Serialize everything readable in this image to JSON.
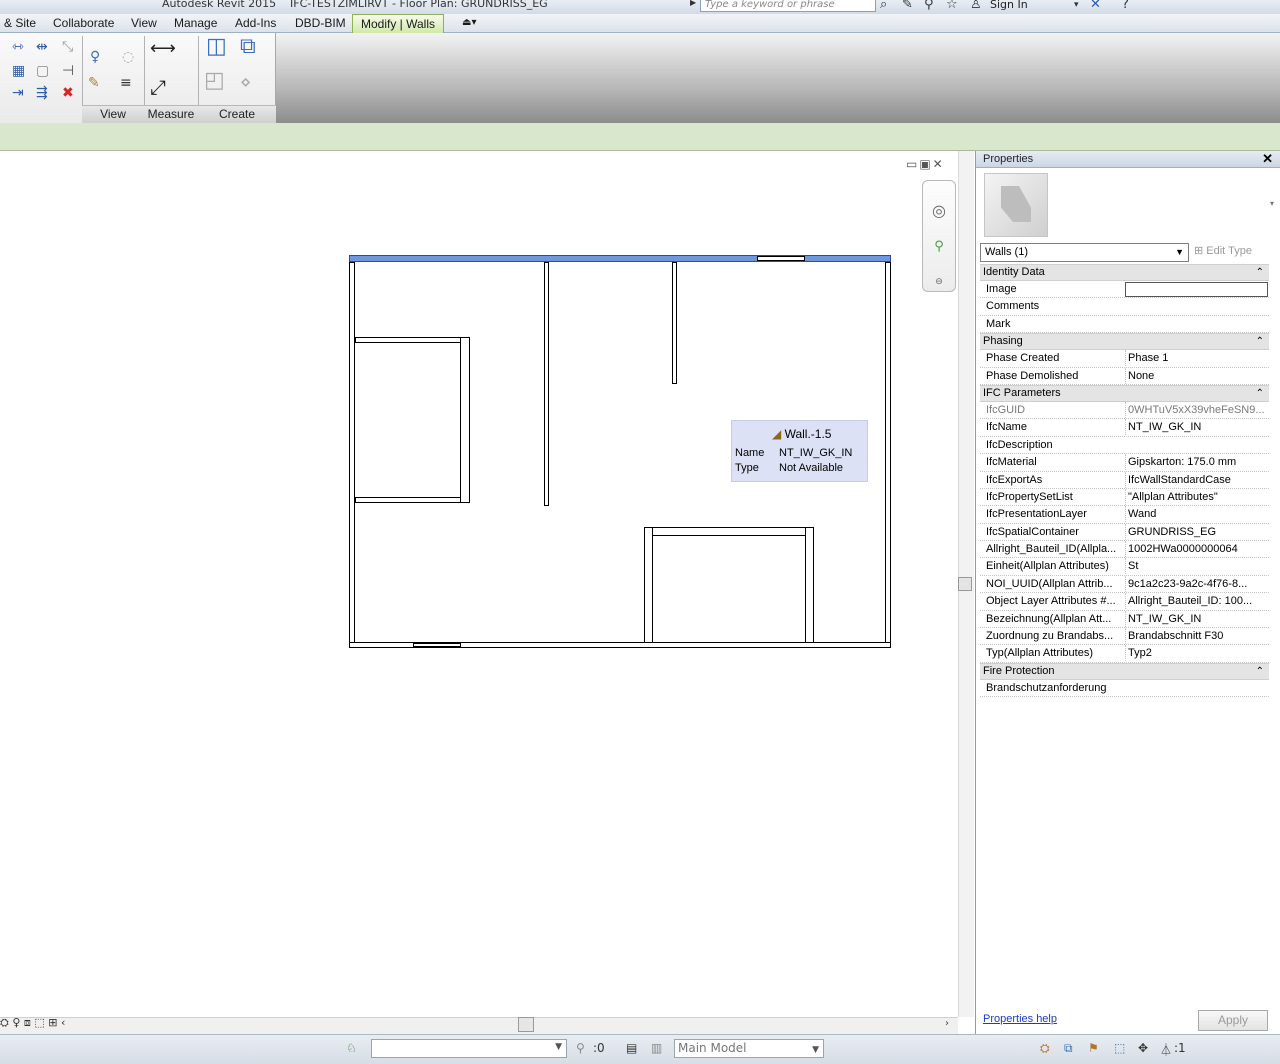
{
  "titlebar": {
    "app": "Autodesk Revit 2015",
    "file": "IFC-TESTZIMLIRVT - Floor Plan: GRUNDRISS_EG",
    "search_placeholder": "Type a keyword or phrase",
    "sign_in": "Sign In"
  },
  "ribbon": {
    "tabs": [
      "& Site",
      "Collaborate",
      "View",
      "Manage",
      "Add-Ins",
      "DBD-BIM"
    ],
    "active_tab": "Modify | Walls",
    "groups": [
      "View",
      "Measure",
      "Create"
    ]
  },
  "tooltip": {
    "title": "Wall.-1.5",
    "name_label": "Name",
    "name_value": "NT_IW_GK_IN",
    "type_label": "Type",
    "type_value": "Not Available"
  },
  "properties": {
    "title": "Properties",
    "selector": "Walls (1)",
    "edit_type": "Edit Type",
    "groups": [
      {
        "name": "Identity Data",
        "rows": [
          {
            "name": "Image",
            "value": "",
            "readonly": false,
            "edit": true
          },
          {
            "name": "Comments",
            "value": "",
            "readonly": false
          },
          {
            "name": "Mark",
            "value": "",
            "readonly": false
          }
        ]
      },
      {
        "name": "Phasing",
        "rows": [
          {
            "name": "Phase Created",
            "value": "Phase 1",
            "readonly": false
          },
          {
            "name": "Phase Demolished",
            "value": "None",
            "readonly": false
          }
        ]
      },
      {
        "name": "IFC Parameters",
        "rows": [
          {
            "name": "IfcGUID",
            "value": "0WHTuV5xX39vheFeSN9...",
            "readonly": true
          },
          {
            "name": "IfcName",
            "value": "NT_IW_GK_IN",
            "readonly": false
          },
          {
            "name": "IfcDescription",
            "value": "",
            "readonly": false
          },
          {
            "name": "IfcMaterial",
            "value": "Gipskarton: 175.0 mm",
            "readonly": false
          },
          {
            "name": "IfcExportAs",
            "value": "IfcWallStandardCase",
            "readonly": false
          },
          {
            "name": "IfcPropertySetList",
            "value": "\"Allplan Attributes\"",
            "readonly": false
          },
          {
            "name": "IfcPresentationLayer",
            "value": "Wand",
            "readonly": false
          },
          {
            "name": "IfcSpatialContainer",
            "value": "GRUNDRISS_EG",
            "readonly": false
          },
          {
            "name": "Allright_Bauteil_ID(Allpla...",
            "value": "1002HWa0000000064",
            "readonly": false
          },
          {
            "name": "Einheit(Allplan Attributes)",
            "value": "St",
            "readonly": false
          },
          {
            "name": "NOI_UUID(Allplan Attrib...",
            "value": "9c1a2c23-9a2c-4f76-8...",
            "readonly": false
          },
          {
            "name": "Object Layer Attributes #...",
            "value": "Allright_Bauteil_ID: 100...",
            "readonly": false
          },
          {
            "name": "Bezeichnung(Allplan Att...",
            "value": "NT_IW_GK_IN",
            "readonly": false
          },
          {
            "name": "Zuordnung zu Brandabs...",
            "value": "Brandabschnitt F30",
            "readonly": false
          },
          {
            "name": "Typ(Allplan Attributes)",
            "value": "Typ2",
            "readonly": false
          }
        ]
      },
      {
        "name": "Fire Protection",
        "rows": [
          {
            "name": "Brandschutzanforderung",
            "value": "",
            "readonly": false
          }
        ]
      }
    ],
    "help_link": "Properties help",
    "apply": "Apply"
  },
  "statusbar": {
    "count": ":0",
    "model": "Main Model",
    "filter_count": ":1"
  },
  "colors": {
    "ribbon_active": "#cfe8a6",
    "options_bar": "#d9e8cc",
    "selected_wall": "#6f96e0",
    "tooltip_bg": "#dde1f5"
  }
}
